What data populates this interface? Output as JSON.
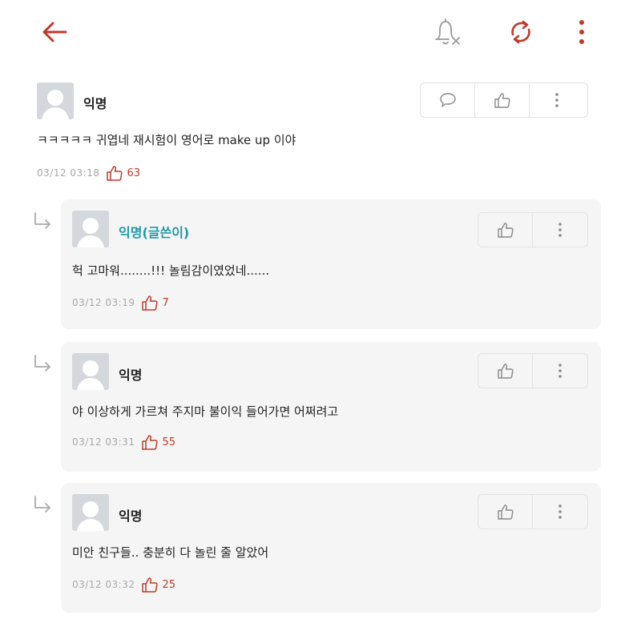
{
  "header": {
    "back_icon": "back-arrow-icon",
    "bell_icon": "notification-off-icon",
    "refresh_icon": "refresh-icon",
    "more_icon": "more-vertical-icon",
    "accent_color": "#c0392b"
  },
  "comments": [
    {
      "author": "익명",
      "text": "ㅋㅋㅋㅋㅋ 귀엽네 재시험이 영어로 make up 이야",
      "time": "03/12 03:18",
      "likes": "63"
    },
    {
      "author": "익명(글쓴이)",
      "text": "헉 고마워........!!! 놀림감이였었네......",
      "time": "03/12 03:19",
      "likes": "7"
    },
    {
      "author": "익명",
      "text": "야 이상하게 가르쳐 주지마 불이익 들어가면 어쩌려고",
      "time": "03/12 03:31",
      "likes": "55"
    },
    {
      "author": "익명",
      "text": "미안 친구들.. 충분히 다 놀린 줄 알았어",
      "time": "03/12 03:32",
      "likes": "25"
    }
  ]
}
